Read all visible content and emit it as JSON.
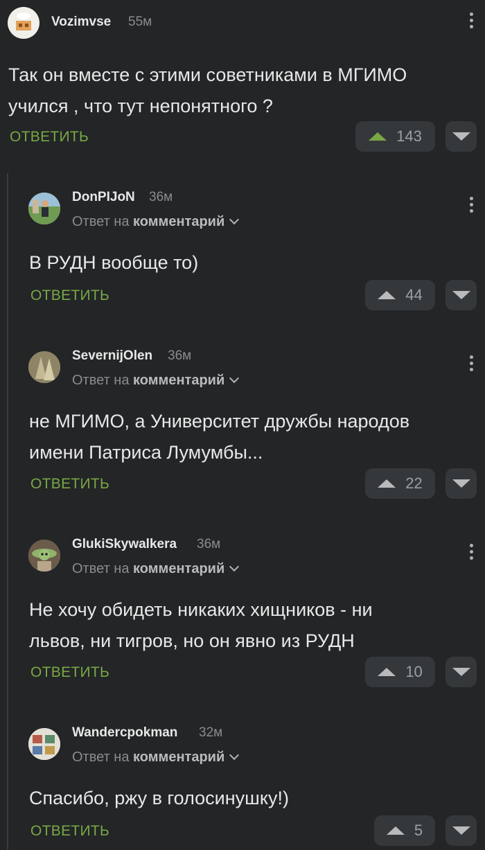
{
  "comments": [
    {
      "author": "Vozimvse",
      "time": "55м",
      "text_lines": [
        "Так он вместе с этими советниками в МГИМО",
        "учился , что тут непонятного ?"
      ],
      "reply_label": "ОТВЕТИТЬ",
      "votes": "143",
      "vote_active": true
    },
    {
      "author": "DonPIJoN",
      "time": "36м",
      "reply_prefix": "Ответ на",
      "reply_target": "комментарий",
      "text_lines": [
        "В РУДН вообще то)"
      ],
      "reply_label": "ОТВЕТИТЬ",
      "votes": "44"
    },
    {
      "author": "SevernijOlen",
      "time": "36м",
      "reply_prefix": "Ответ на",
      "reply_target": "комментарий",
      "text_lines": [
        "не МГИМО, а Университет дружбы народов",
        "имени Патриса Лумумбы..."
      ],
      "reply_label": "ОТВЕТИТЬ",
      "votes": "22"
    },
    {
      "author": "GlukiSkywalkera",
      "time": "36м",
      "reply_prefix": "Ответ на",
      "reply_target": "комментарий",
      "text_lines": [
        "Не хочу обидеть никаких хищников - ни",
        "львов, ни тигров, но он явно из РУДН"
      ],
      "reply_label": "ОТВЕТИТЬ",
      "votes": "10"
    },
    {
      "author": "Wandercpokman",
      "time": "32м",
      "reply_prefix": "Ответ на",
      "reply_target": "комментарий",
      "text_lines": [
        "Спасибо, ржу в голосинушку!)"
      ],
      "reply_label": "ОТВЕТИТЬ",
      "votes": "5"
    }
  ],
  "icons": {
    "upvote": "triangle-up-icon",
    "downvote": "triangle-down-icon",
    "menu": "more-vertical-icon",
    "chevron": "chevron-down-icon"
  },
  "colors": {
    "background": "#232527",
    "accent": "#79a845",
    "vote_bg": "#35383b"
  }
}
